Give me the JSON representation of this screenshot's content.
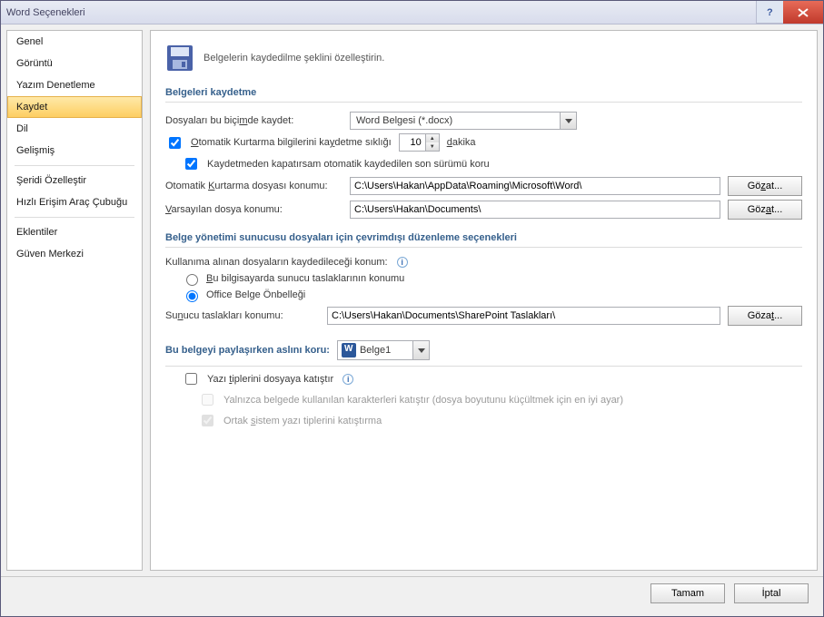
{
  "title": "Word Seçenekleri",
  "sidebar": {
    "items": [
      {
        "label": "Genel"
      },
      {
        "label": "Görüntü"
      },
      {
        "label": "Yazım Denetleme"
      },
      {
        "label": "Kaydet",
        "selected": true
      },
      {
        "label": "Dil"
      },
      {
        "label": "Gelişmiş"
      },
      {
        "sep": true
      },
      {
        "label": "Şeridi Özelleştir"
      },
      {
        "label": "Hızlı Erişim Araç Çubuğu"
      },
      {
        "sep": true
      },
      {
        "label": "Eklentiler"
      },
      {
        "label": "Güven Merkezi"
      }
    ]
  },
  "header": {
    "subtitle": "Belgelerin kaydedilme şeklini özelleştirin."
  },
  "group_save": {
    "title": "Belgeleri kaydetme",
    "format_label": "Dosyaları bu biçimde kaydet:",
    "format_value": "Word Belgesi (*.docx)",
    "autorec_label_pre": "Otomatik Kurtarma bilgilerini kaydetme sıklığı",
    "autorec_value": "10",
    "autorec_label_post": "dakika",
    "autorec_checked": true,
    "keep_last_label": "Kaydetmeden kapatırsam otomatik kaydedilen son sürümü koru",
    "keep_last_checked": true,
    "autorec_loc_label": "Otomatik Kurtarma dosyası konumu:",
    "autorec_loc_value": "C:\\Users\\Hakan\\AppData\\Roaming\\Microsoft\\Word\\",
    "default_loc_label": "Varsayılan dosya konumu:",
    "default_loc_value": "C:\\Users\\Hakan\\Documents\\",
    "browse": "Gözat..."
  },
  "group_offline": {
    "title": "Belge yönetimi sunucusu dosyaları için çevrimdışı düzenleme seçenekleri",
    "checked_out_label": "Kullanıma alınan dosyaların kaydedileceği konum:",
    "opt_server_drafts": "Bu bilgisayarda sunucu taslaklarının konumu",
    "opt_cache": "Office Belge Önbelleği",
    "selected_radio": "cache",
    "drafts_loc_label": "Sunucu taslakları konumu:",
    "drafts_loc_value": "C:\\Users\\Hakan\\Documents\\SharePoint Taslakları\\",
    "browse": "Gözat..."
  },
  "group_preserve": {
    "title": "Bu belgeyi paylaşırken aslını koru:",
    "doc_value": "Belge1",
    "embed_fonts_label": "Yazı tiplerini dosyaya katıştır",
    "embed_fonts_checked": false,
    "embed_subset_label": "Yalnızca belgede kullanılan karakterleri katıştır (dosya boyutunu küçültmek için en iyi ayar)",
    "embed_subset_checked": false,
    "embed_sys_label": "Ortak sistem yazı tiplerini katıştırma",
    "embed_sys_checked": true
  },
  "footer": {
    "ok": "Tamam",
    "cancel": "İptal"
  }
}
